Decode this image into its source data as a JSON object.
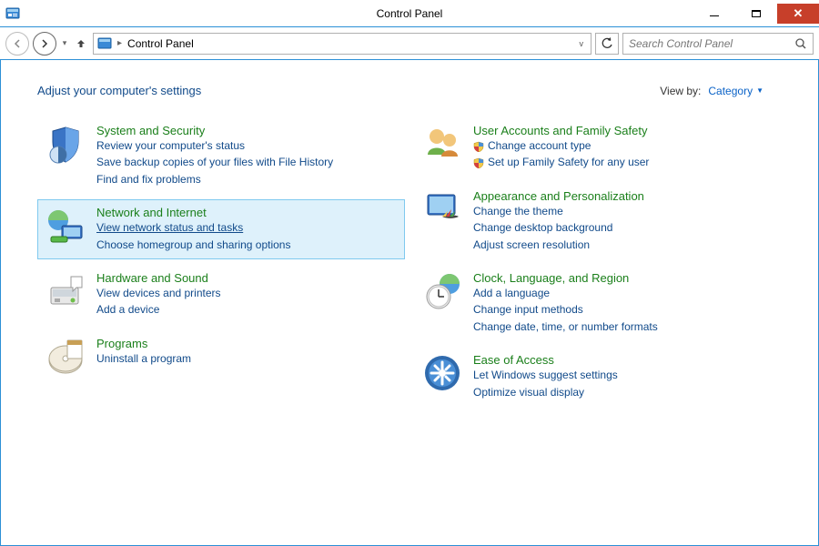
{
  "window": {
    "title": "Control Panel"
  },
  "breadcrumb": {
    "root": "Control Panel"
  },
  "search": {
    "placeholder": "Search Control Panel"
  },
  "header": {
    "title": "Adjust your computer's settings",
    "viewby_label": "View by:",
    "viewby_value": "Category"
  },
  "left": [
    {
      "icon": "security",
      "title": "System and Security",
      "selected": false,
      "links": [
        {
          "text": "Review your computer's status"
        },
        {
          "text": "Save backup copies of your files with File History"
        },
        {
          "text": "Find and fix problems"
        }
      ]
    },
    {
      "icon": "network",
      "title": "Network and Internet",
      "selected": true,
      "links": [
        {
          "text": "View network status and tasks",
          "underlined": true
        },
        {
          "text": "Choose homegroup and sharing options"
        }
      ]
    },
    {
      "icon": "hardware",
      "title": "Hardware and Sound",
      "selected": false,
      "links": [
        {
          "text": "View devices and printers"
        },
        {
          "text": "Add a device"
        }
      ]
    },
    {
      "icon": "programs",
      "title": "Programs",
      "selected": false,
      "links": [
        {
          "text": "Uninstall a program"
        }
      ]
    }
  ],
  "right": [
    {
      "icon": "users",
      "title": "User Accounts and Family Safety",
      "selected": false,
      "links": [
        {
          "text": "Change account type",
          "shield": true
        },
        {
          "text": "Set up Family Safety for any user",
          "shield": true
        }
      ]
    },
    {
      "icon": "appearance",
      "title": "Appearance and Personalization",
      "selected": false,
      "links": [
        {
          "text": "Change the theme"
        },
        {
          "text": "Change desktop background"
        },
        {
          "text": "Adjust screen resolution"
        }
      ]
    },
    {
      "icon": "clock",
      "title": "Clock, Language, and Region",
      "selected": false,
      "links": [
        {
          "text": "Add a language"
        },
        {
          "text": "Change input methods"
        },
        {
          "text": "Change date, time, or number formats"
        }
      ]
    },
    {
      "icon": "ease",
      "title": "Ease of Access",
      "selected": false,
      "links": [
        {
          "text": "Let Windows suggest settings"
        },
        {
          "text": "Optimize visual display"
        }
      ]
    }
  ]
}
